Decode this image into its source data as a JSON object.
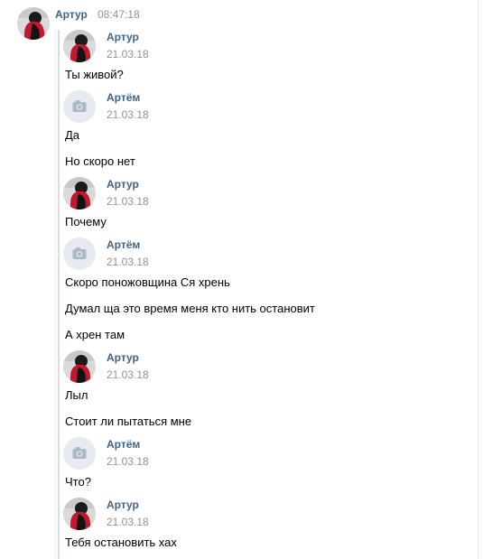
{
  "top_message": {
    "sender": "Артур",
    "time": "08:47:18"
  },
  "forwarded": [
    {
      "sender": "Артур",
      "date": "21.03.18",
      "avatar": "photo-avatar",
      "lines": [
        "Ты живой?"
      ]
    },
    {
      "sender": "Артём",
      "date": "21.03.18",
      "avatar": "camera-icon",
      "lines": [
        "Да",
        "Но скоро нет"
      ]
    },
    {
      "sender": "Артур",
      "date": "21.03.18",
      "avatar": "photo-avatar",
      "lines": [
        "Почему"
      ]
    },
    {
      "sender": "Артём",
      "date": "21.03.18",
      "avatar": "camera-icon",
      "lines": [
        "Скоро поножовщина Ся хрень",
        "Думал ща это время меня кто нить остановит",
        "А хрен там"
      ]
    },
    {
      "sender": "Артур",
      "date": "21.03.18",
      "avatar": "photo-avatar",
      "lines": [
        "Лыл",
        "Стоит ли пытаться мне"
      ]
    },
    {
      "sender": "Артём",
      "date": "21.03.18",
      "avatar": "camera-icon",
      "lines": [
        "Что?"
      ]
    },
    {
      "sender": "Артур",
      "date": "21.03.18",
      "avatar": "photo-avatar",
      "lines": [
        "Тебя остановить хах"
      ]
    }
  ],
  "colors": {
    "name": "#42648b",
    "meta": "#939393",
    "forward_bar": "#d7dde5"
  }
}
